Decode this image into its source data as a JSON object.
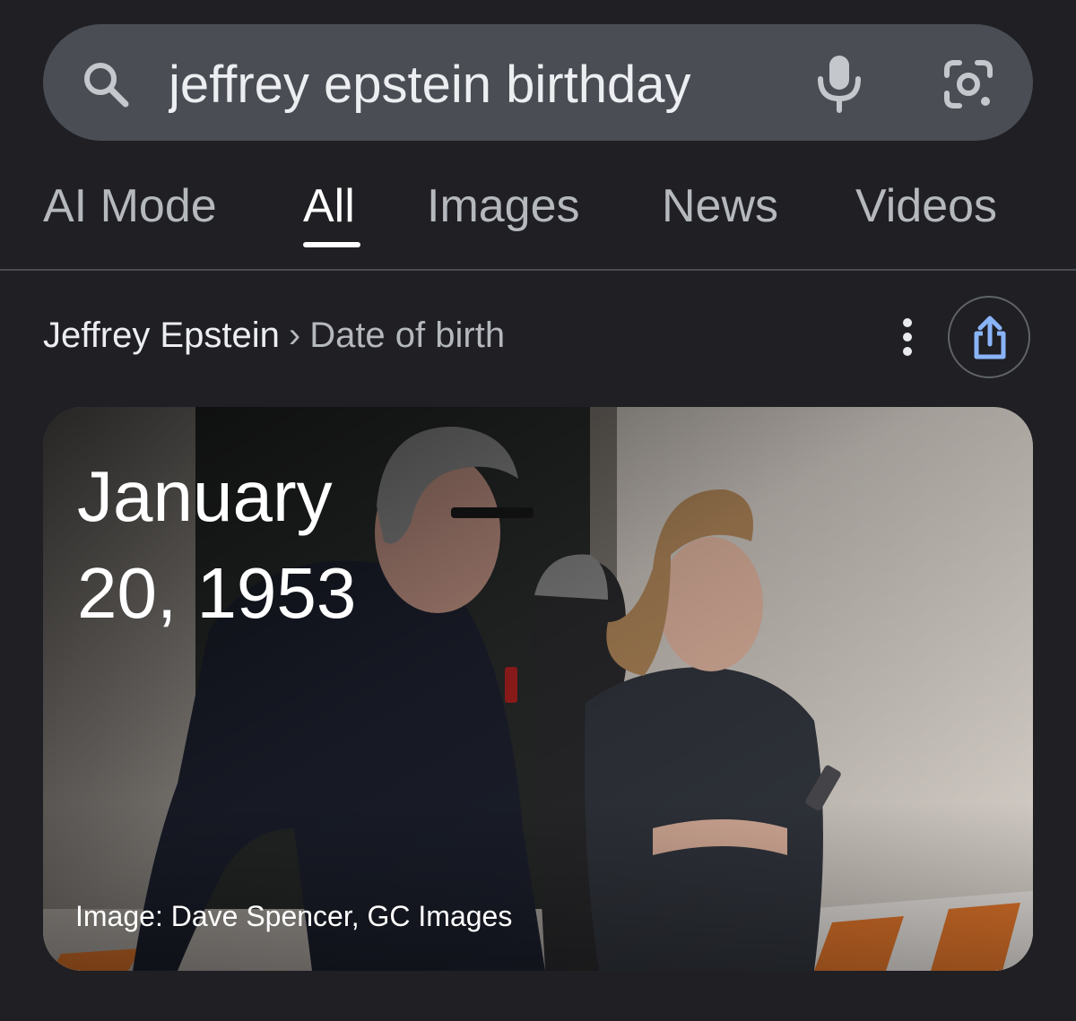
{
  "search": {
    "query": "jeffrey epstein birthday"
  },
  "tabs": [
    {
      "label": "AI Mode",
      "active": false
    },
    {
      "label": "All",
      "active": true
    },
    {
      "label": "Images",
      "active": false
    },
    {
      "label": "News",
      "active": false
    },
    {
      "label": "Videos",
      "active": false
    }
  ],
  "breadcrumb": {
    "entity": "Jeffrey Epstein",
    "separator": "›",
    "attribute": "Date of birth"
  },
  "answer": {
    "date_line_1": "January",
    "date_line_2": "20, 1953",
    "image_credit": "Image: Dave Spencer, GC Images"
  },
  "icons": {
    "search": "search-icon",
    "mic": "mic-icon",
    "lens": "google-lens-icon",
    "more": "more-vert-icon",
    "share": "share-icon"
  },
  "colors": {
    "background": "#1f1f24",
    "search_bar": "#4a4e54",
    "share_accent": "#8ab4f8"
  }
}
